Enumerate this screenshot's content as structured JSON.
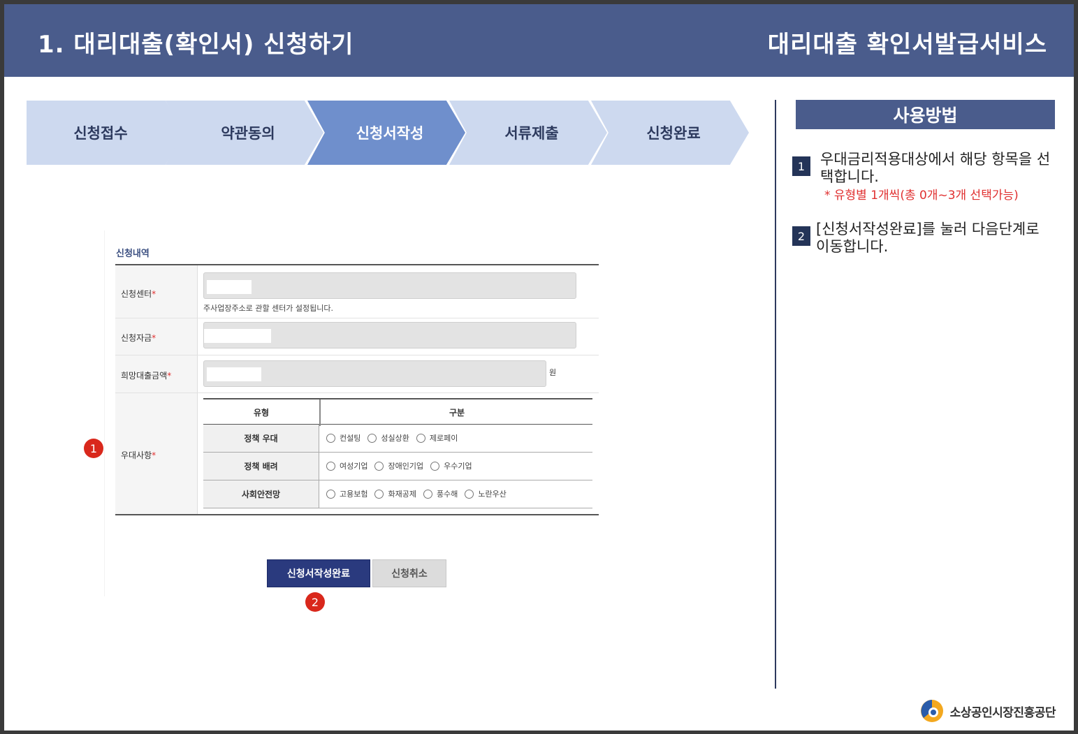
{
  "header": {
    "title_left": "1. 대리대출(확인서) 신청하기",
    "title_right": "대리대출 확인서발급서비스"
  },
  "steps": [
    {
      "label": "신청접수",
      "active": false
    },
    {
      "label": "약관동의",
      "active": false
    },
    {
      "label": "신청서작성",
      "active": true
    },
    {
      "label": "서류제출",
      "active": false
    },
    {
      "label": "신청완료",
      "active": false
    }
  ],
  "usage": {
    "title": "사용방법",
    "items": [
      {
        "num": "1",
        "text": "우대금리적용대상에서 해당 항목을 선택합니다.",
        "note": "* 유형별 1개씩(총 0개~3개 선택가능)"
      },
      {
        "num": "2",
        "text": "[신청서작성완료]를 눌러 다음단계로 이동합니다.",
        "note": ""
      }
    ]
  },
  "form": {
    "section_title": "신청내역",
    "fields": {
      "center": {
        "label": "신청센터",
        "required": "*",
        "hint": "주사업장주소로 관할 센터가 설정됩니다."
      },
      "fund": {
        "label": "신청자금",
        "required": "*"
      },
      "amount": {
        "label": "희망대출금액",
        "required": "*",
        "unit": "원"
      },
      "preference": {
        "label": "우대사항",
        "required": "*"
      }
    },
    "preference_table": {
      "col_type": "유형",
      "col_category": "구분",
      "rows": [
        {
          "type": "정책 우대",
          "options": [
            "컨설팅",
            "성실상환",
            "제로페이"
          ]
        },
        {
          "type": "정책 배려",
          "options": [
            "여성기업",
            "장애인기업",
            "우수기업"
          ]
        },
        {
          "type": "사회안전망",
          "options": [
            "고용보험",
            "화재공제",
            "풍수해",
            "노란우산"
          ]
        }
      ]
    },
    "buttons": {
      "submit": "신청서작성완료",
      "cancel": "신청취소"
    }
  },
  "markers": {
    "m1": "1",
    "m2": "2"
  },
  "logo": {
    "text": "소상공인시장진흥공단"
  },
  "colors": {
    "header": "#4a5c8c",
    "step_active": "#6f8fcc",
    "step_inactive": "#cdd9ef",
    "marker": "#d9281c",
    "note": "#e03030"
  }
}
